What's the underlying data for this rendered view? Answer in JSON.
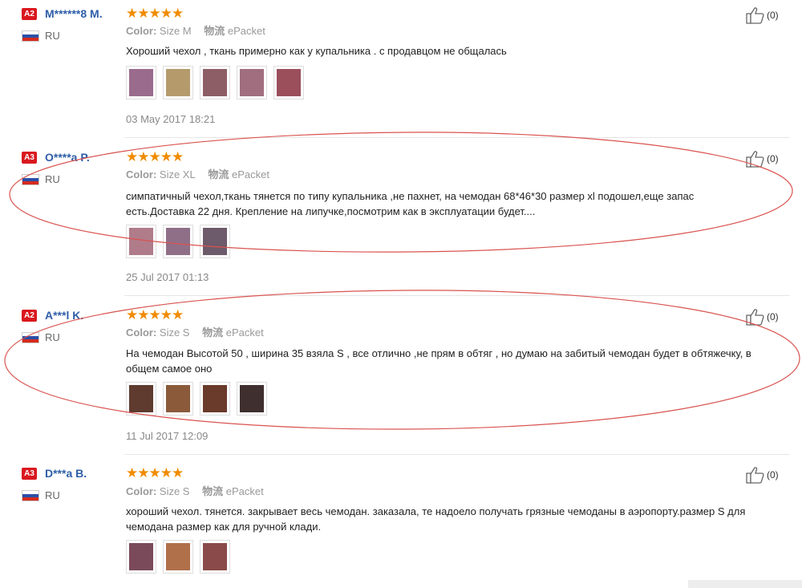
{
  "labels": {
    "color_key": "Color:",
    "shipping_key": "物流"
  },
  "reviews": [
    {
      "level": "A2",
      "name": "M******8 M.",
      "country": "RU",
      "stars": "★★★★★",
      "color": "Size M",
      "shipping": "ePacket",
      "text": "Хороший чехол , ткань примерно как у купальника . с продавцом не общалась",
      "date": "03 May 2017 18:21",
      "likes": "(0)",
      "thumb_colors": [
        "#9a6b8d",
        "#b59b6c",
        "#8e5e67",
        "#a06e7f",
        "#9a4f5b"
      ]
    },
    {
      "level": "A3",
      "name": "O****a P.",
      "country": "RU",
      "stars": "★★★★★",
      "color": "Size XL",
      "shipping": "ePacket",
      "text": "симпатичный чехол,ткань тянется по типу купальника ,не пахнет, на чемодан 68*46*30 размер xl подошел,еще запас есть.Доставка 22 дня. Крепление на липучке,посмотрим как в эксплуатации будет....",
      "date": "25 Jul 2017 01:13",
      "likes": "(0)",
      "thumb_colors": [
        "#b07c8a",
        "#8f6f88",
        "#6d5a6a"
      ]
    },
    {
      "level": "A2",
      "name": "A***l K.",
      "country": "RU",
      "stars": "★★★★★",
      "color": "Size S",
      "shipping": "ePacket",
      "text": "На чемодан Высотой 50 , ширина 35 взяла S , все отлично ,не прям в обтяг , но думаю на забитый чемодан будет в обтяжечку, в общем самое оно",
      "date": "11 Jul 2017 12:09",
      "likes": "(0)",
      "thumb_colors": [
        "#5e3a2f",
        "#8a5a3a",
        "#6a3a2a",
        "#3f2f2f"
      ]
    },
    {
      "level": "A3",
      "name": "D***a B.",
      "country": "RU",
      "stars": "★★★★★",
      "color": "Size S",
      "shipping": "ePacket",
      "text": "хороший чехол. тянется. закрывает весь чемодан. заказала, те надоело получать грязные чемоданы в аэропорту.размер S для чемодана размер как для ручной клади.",
      "date": "",
      "likes": "(0)",
      "thumb_colors": [
        "#7a4a5a",
        "#b0704a",
        "#8a4a4a"
      ]
    }
  ],
  "colors": {
    "oval": "#d9534f",
    "flag_white": "#ffffff",
    "flag_blue": "#2a4fa8",
    "flag_red": "#d52b1e"
  }
}
